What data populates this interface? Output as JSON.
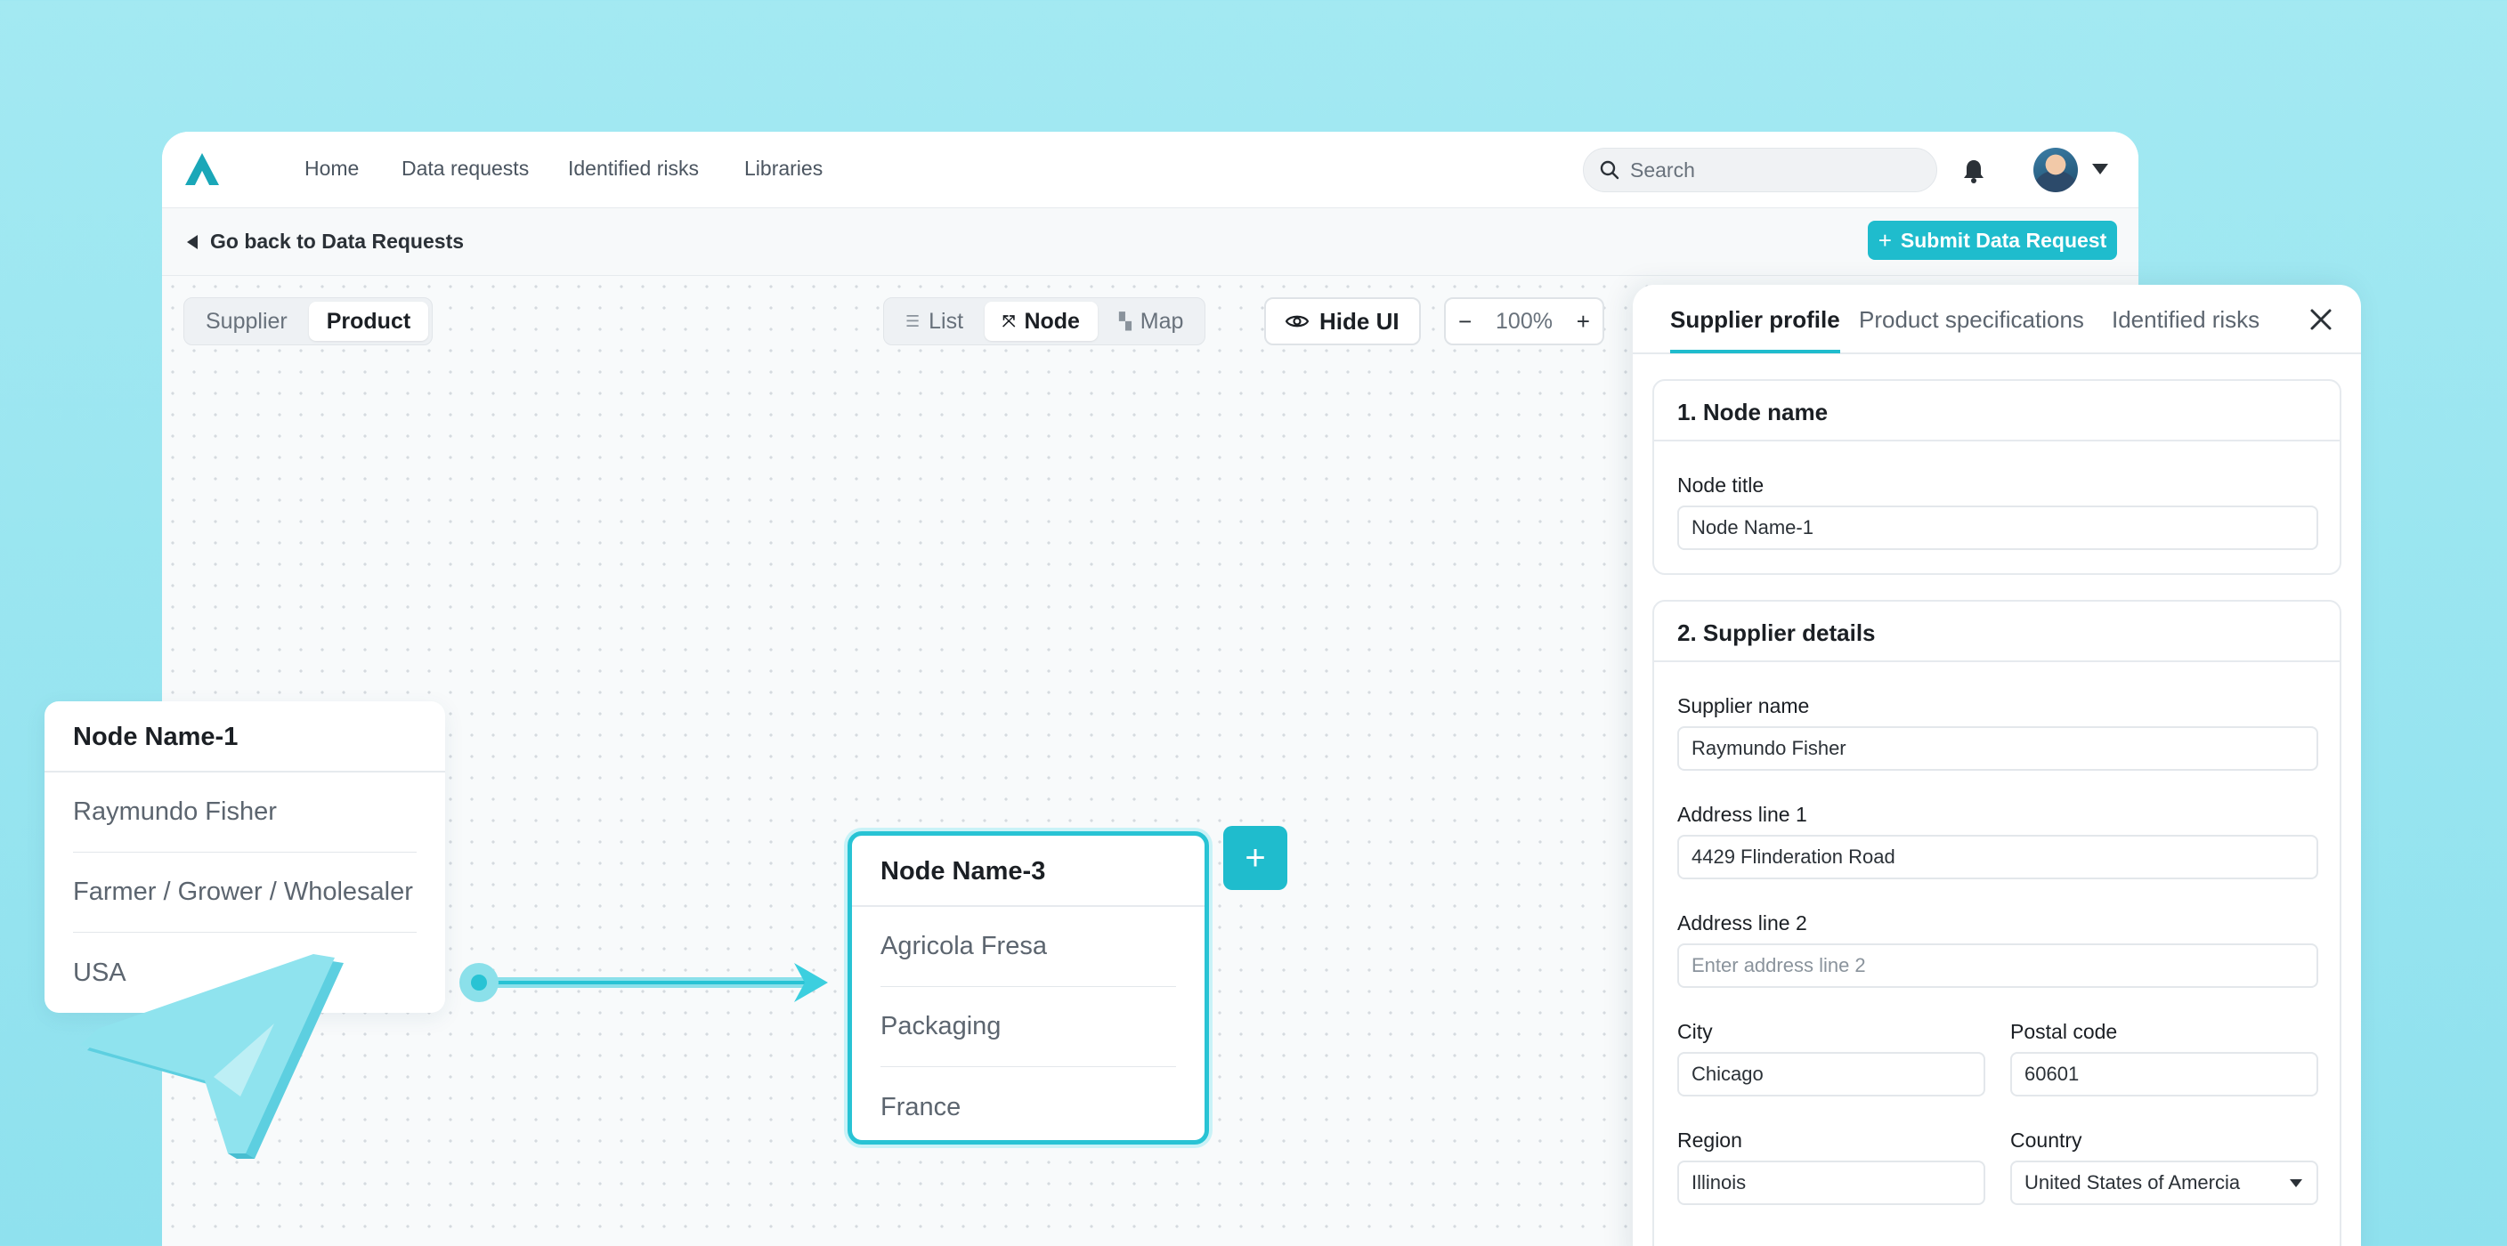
{
  "nav": {
    "links": [
      "Home",
      "Data requests",
      "Identified risks",
      "Libraries"
    ],
    "search_placeholder": "Search"
  },
  "subbar": {
    "back_label": "Go back to Data Requests",
    "submit_label": "Submit Data Request"
  },
  "toolbar": {
    "entity_toggle": [
      "Supplier",
      "Product"
    ],
    "entity_selected": "Product",
    "view_toggle": [
      "List",
      "Node",
      "Map"
    ],
    "view_selected": "Node",
    "hide_ui_label": "Hide UI",
    "zoom_level": "100%"
  },
  "nodes": [
    {
      "title": "Node Name-1",
      "rows": [
        "Raymundo Fisher",
        "Farmer / Grower / Wholesaler",
        "USA"
      ]
    },
    {
      "title": "Node Name-3",
      "rows": [
        "Agricola Fresa",
        "Packaging",
        "France"
      ]
    }
  ],
  "panel": {
    "tabs": [
      "Supplier profile",
      "Product specifications",
      "Identified risks"
    ],
    "active_tab": "Supplier profile",
    "section1": {
      "title": "1. Node name",
      "node_title_label": "Node title",
      "node_title_value": "Node Name-1"
    },
    "section2": {
      "title": "2. Supplier details",
      "supplier_name_label": "Supplier name",
      "supplier_name_value": "Raymundo Fisher",
      "address1_label": "Address line 1",
      "address1_value": "4429 Flinderation Road",
      "address2_label": "Address line 2",
      "address2_placeholder": "Enter address line 2",
      "city_label": "City",
      "city_value": "Chicago",
      "postal_label": "Postal code",
      "postal_value": "60601",
      "region_label": "Region",
      "region_value": "Illinois",
      "country_label": "Country",
      "country_value": "United States of Amercia"
    }
  },
  "colors": {
    "accent": "#1fbccd",
    "background": "#a3e9f2",
    "selected_node_border": "#28c3d4"
  },
  "icons": [
    "logo-icon",
    "search-icon",
    "bell-icon",
    "chevron-down-icon",
    "arrow-left-icon",
    "plus-icon",
    "list-icon",
    "node-icon",
    "map-icon",
    "eye-icon",
    "minus-icon",
    "close-icon",
    "arrow-icon"
  ]
}
